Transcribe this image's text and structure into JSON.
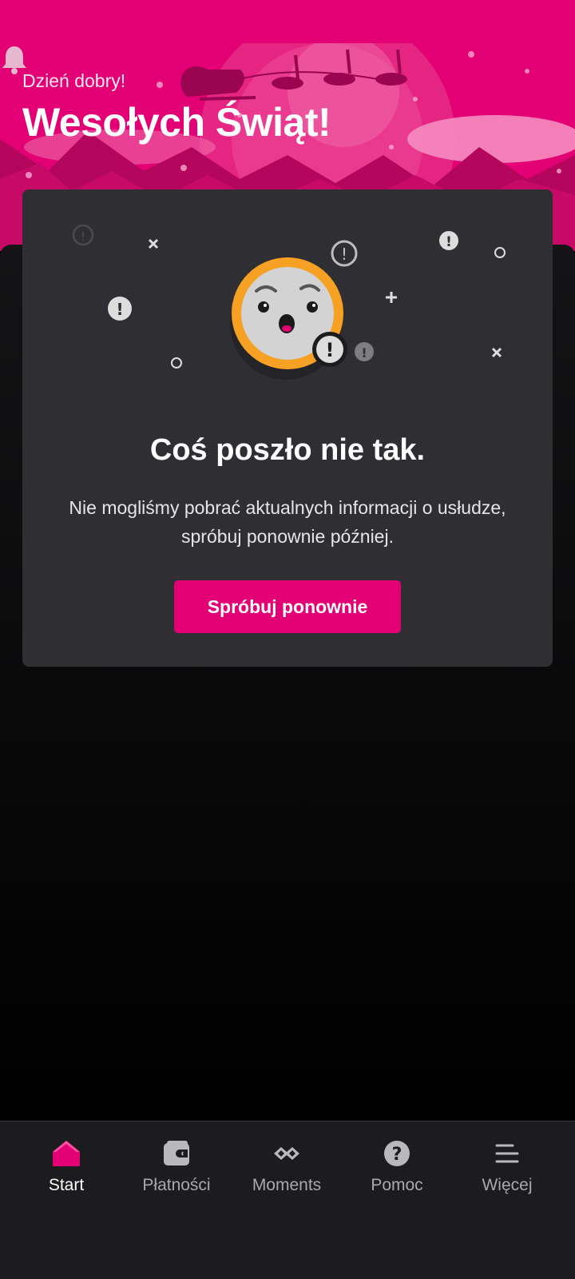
{
  "header": {
    "greeting": "Dzień dobry!",
    "title": "Wesołych Świąt!"
  },
  "error": {
    "title": "Coś poszło nie tak.",
    "description": "Nie mogliśmy pobrać aktualnych informacji o usłudze, spróbuj ponownie później.",
    "retry_label": "Spróbuj ponownie"
  },
  "nav": {
    "items": [
      {
        "label": "Start",
        "icon": "home-icon",
        "active": true
      },
      {
        "label": "Płatności",
        "icon": "wallet-icon",
        "active": false
      },
      {
        "label": "Moments",
        "icon": "moments-icon",
        "active": false
      },
      {
        "label": "Pomoc",
        "icon": "help-icon",
        "active": false
      },
      {
        "label": "Więcej",
        "icon": "menu-icon",
        "active": false
      }
    ]
  },
  "colors": {
    "brand": "#e20074",
    "card": "#2e2e33",
    "nav_bg": "#1c1c1f"
  }
}
